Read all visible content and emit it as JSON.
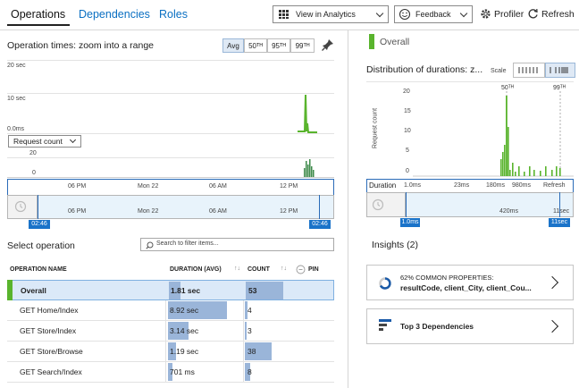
{
  "tabs": {
    "operations": "Operations",
    "dependencies": "Dependencies",
    "roles": "Roles"
  },
  "toolbar": {
    "view_in_analytics": "View in Analytics",
    "feedback": "Feedback",
    "profiler": "Profiler",
    "refresh": "Refresh"
  },
  "operation_times": {
    "title": "Operation times: zoom into a range",
    "percentiles": [
      "Avg",
      "50ᵀᴴ",
      "95ᵀᴴ",
      "99ᵀᴴ"
    ],
    "y_labels": [
      "20 sec",
      "10 sec",
      "0.0ms"
    ],
    "metric_select": "Request count",
    "count_labels": [
      "20",
      "0"
    ],
    "time_ticks": [
      "06 PM",
      "Mon 22",
      "06 AM",
      "12 PM"
    ],
    "range_start": "02:46",
    "range_end": "02:46",
    "zoom_icon": "history-icon"
  },
  "select_operation": {
    "title": "Select operation",
    "filter_placeholder": "Search to filter items..."
  },
  "table": {
    "headers": {
      "name": "OPERATION NAME",
      "duration": "DURATION (AVG)",
      "count": "COUNT",
      "pin": "PIN"
    },
    "rows": [
      {
        "name": "Overall",
        "duration": "1.81 sec",
        "count": "53",
        "duration_frac": 0.2,
        "count_frac": 1.0
      },
      {
        "name": "GET Home/Index",
        "duration": "8.92 sec",
        "count": "4",
        "duration_frac": 1.0,
        "count_frac": 0.075
      },
      {
        "name": "GET Store/Index",
        "duration": "3.14 sec",
        "count": "3",
        "duration_frac": 0.35,
        "count_frac": 0.057
      },
      {
        "name": "GET Store/Browse",
        "duration": "1.19 sec",
        "count": "38",
        "duration_frac": 0.135,
        "count_frac": 0.717
      },
      {
        "name": "GET Search/Index",
        "duration": "701 ms",
        "count": "8",
        "duration_frac": 0.08,
        "count_frac": 0.15
      }
    ]
  },
  "right_panel": {
    "overall_label": "Overall",
    "distribution_title": "Distribution of durations: z...",
    "scale_label": "Scale",
    "y_axis_label": "Request count",
    "y_ticks": [
      "20",
      "15",
      "10",
      "5",
      "0"
    ],
    "percentile_markers": [
      "50ᵀᴴ",
      "99ᵀᴴ"
    ],
    "duration_label": "Duration",
    "duration_ticks": [
      "1.0ms",
      "23ms",
      "180ms",
      "980ms",
      "Refresh"
    ],
    "lower_ticks": [
      "420ms",
      "11sec"
    ],
    "range_start": "1.0ms",
    "range_end": "11sec",
    "insights_title": "Insights (2)",
    "card1_line1": "62% COMMON PROPERTIES:",
    "card1_line2": "resultCode, client_City, client_Cou...",
    "card2_title": "Top 3 Dependencies"
  },
  "colors": {
    "accent": "#0a6fc2",
    "green": "#59b42d",
    "bar_blue": "#9ab5d9",
    "marker_blue": "#1a73c9"
  }
}
